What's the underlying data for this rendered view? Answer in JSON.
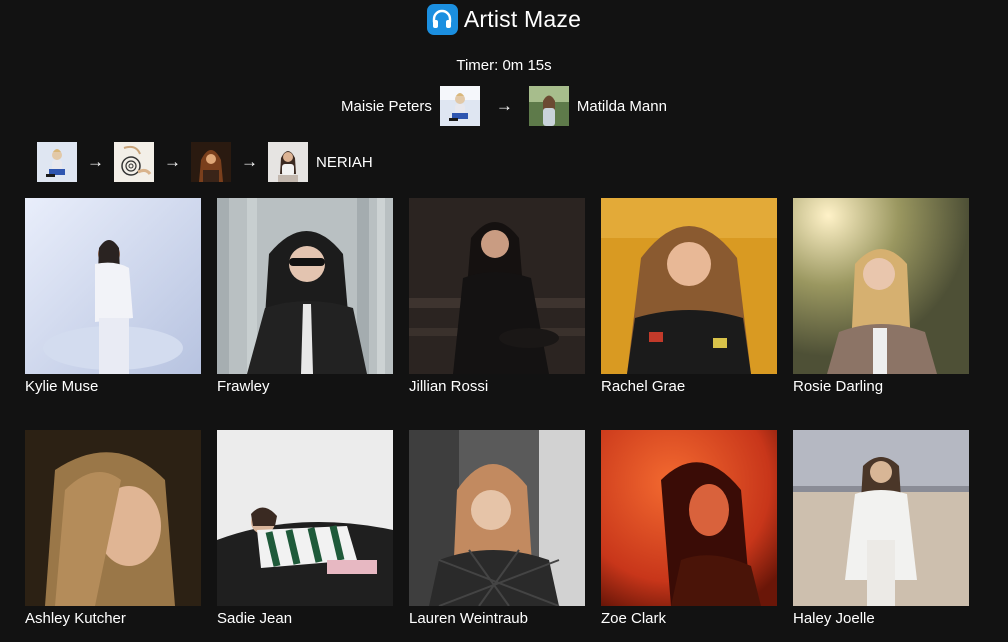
{
  "app": {
    "title": "Artist Maze",
    "logo_icon": "headphones-icon",
    "accent_color": "#1b8fe0"
  },
  "timer": {
    "text": "Timer: 0m 15s"
  },
  "route": {
    "start": "Maisie Peters",
    "target": "Matilda Mann"
  },
  "path": {
    "current": "NERIAH",
    "steps": 4
  },
  "artists": [
    {
      "name": "Kylie Muse",
      "tone": [
        "#c9d6ea",
        "#eef2fb",
        "#9aa9c8"
      ]
    },
    {
      "name": "Frawley",
      "tone": [
        "#b8c0c3",
        "#d8dcdc",
        "#1d1d1d"
      ]
    },
    {
      "name": "Jillian Rossi",
      "tone": [
        "#2a2320",
        "#4a3f38",
        "#1a1515"
      ]
    },
    {
      "name": "Rachel Grae",
      "tone": [
        "#d79a20",
        "#eab24a",
        "#7a4a20"
      ]
    },
    {
      "name": "Rosie Darling",
      "tone": [
        "#8c8c58",
        "#e3d59a",
        "#5d5b3f"
      ]
    },
    {
      "name": "Ashley Kutcher",
      "tone": [
        "#3a2a1a",
        "#a8855a",
        "#1a120a"
      ]
    },
    {
      "name": "Sadie Jean",
      "tone": [
        "#e4e4e4",
        "#f7f7f7",
        "#2a2a2a"
      ]
    },
    {
      "name": "Lauren Weintraub",
      "tone": [
        "#5c5c5c",
        "#b8a48a",
        "#2a2a2a"
      ]
    },
    {
      "name": "Zoe Clark",
      "tone": [
        "#d2401c",
        "#f0682e",
        "#501008"
      ]
    },
    {
      "name": "Haley Joelle",
      "tone": [
        "#a8aab4",
        "#d8cdbf",
        "#5a4c40"
      ]
    }
  ]
}
